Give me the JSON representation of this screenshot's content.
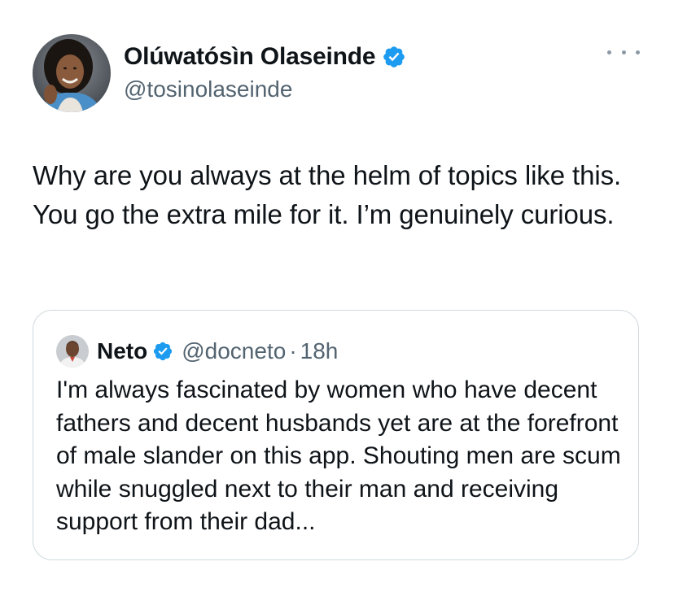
{
  "tweet": {
    "author": {
      "display_name": "Olúwatósìn Olaseinde",
      "handle": "@tosinolaseinde",
      "verified": true,
      "avatar": "profile-photo-avatar"
    },
    "more_icon": "more-horizontal-icon",
    "text": "Why are you always at the helm of topics like this. You go the extra mile for it. I’m genuinely curious."
  },
  "quoted_tweet": {
    "author": {
      "display_name": "Neto",
      "handle": "@docneto",
      "verified": true,
      "avatar": "profile-photo-avatar"
    },
    "separator": "·",
    "time": "18h",
    "text": "I'm always fascinated by women who have decent fathers and decent husbands yet are at the forefront of male slander on this app. Shouting men are scum while snuggled next to their man and receiving support from their dad..."
  },
  "colors": {
    "text_primary": "#0f1419",
    "text_secondary": "#536471",
    "verified_blue": "#1d9bf0",
    "border": "#cfd9de"
  }
}
